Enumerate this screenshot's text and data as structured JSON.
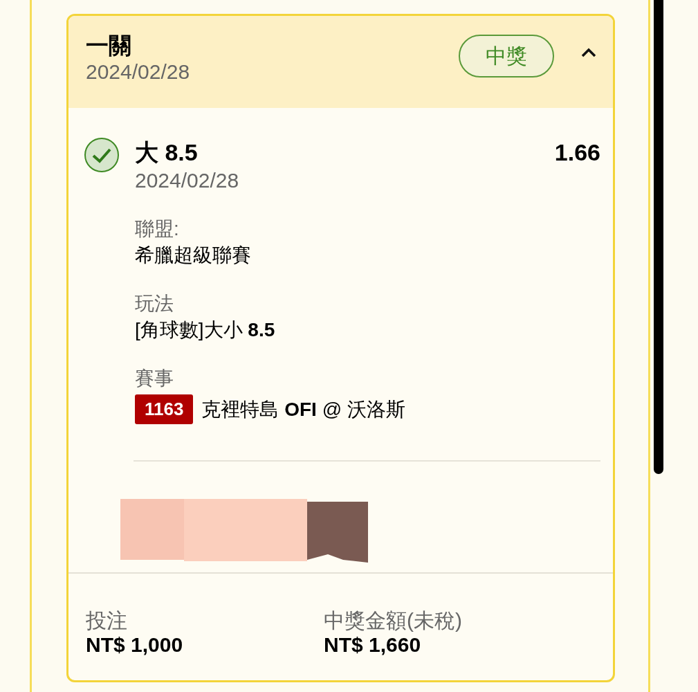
{
  "ticket": {
    "title": "一關",
    "date": "2024/02/28",
    "status": "中獎",
    "expanded": true
  },
  "selection": {
    "won": true,
    "pick": "大 8.5",
    "odds": "1.66",
    "date": "2024/02/28",
    "fields": [
      {
        "label": "聯盟:",
        "value": "希臘超級聯賽"
      },
      {
        "label": "玩法",
        "value": "[角球數]大小 **8.5**"
      },
      {
        "label": "賽事",
        "code": "1163",
        "value": "克裡特島 **OFI** @ 沃洛斯"
      }
    ]
  },
  "footer": [
    {
      "label": "投注",
      "amount": "NT$ 1,000"
    },
    {
      "label": "中獎金額(未稅)",
      "amount": "NT$ 1,660"
    }
  ]
}
